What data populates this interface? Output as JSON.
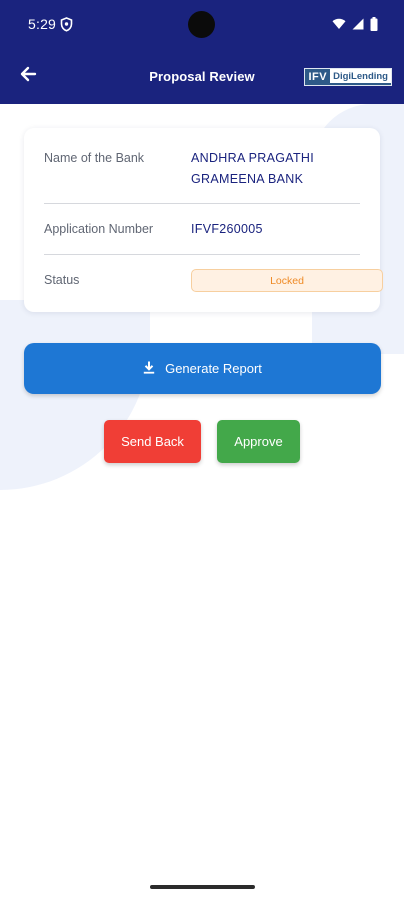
{
  "status_bar": {
    "time": "5:29",
    "icons": [
      "shield-icon",
      "wifi-icon",
      "signal-icon",
      "battery-icon"
    ]
  },
  "app_bar": {
    "title": "Proposal Review",
    "back_icon": "arrow-left-icon",
    "logo": {
      "part1": "IFV",
      "part2": "DigiLending"
    },
    "background_color": "#1a237e"
  },
  "details": {
    "bank": {
      "label": "Name of the Bank",
      "value_line1": "ANDHRA PRAGATHI",
      "value_line2": "GRAMEENA BANK"
    },
    "application": {
      "label": "Application Number",
      "value": "IFVF260005"
    },
    "status": {
      "label": "Status",
      "value": "Locked",
      "color": "#ef8a25"
    }
  },
  "actions": {
    "generate_report": {
      "label": "Generate Report",
      "icon": "download-icon",
      "color": "#1e77d4"
    },
    "send_back": {
      "label": "Send Back",
      "color": "#f03e36"
    },
    "approve": {
      "label": "Approve",
      "color": "#43a84a"
    }
  }
}
